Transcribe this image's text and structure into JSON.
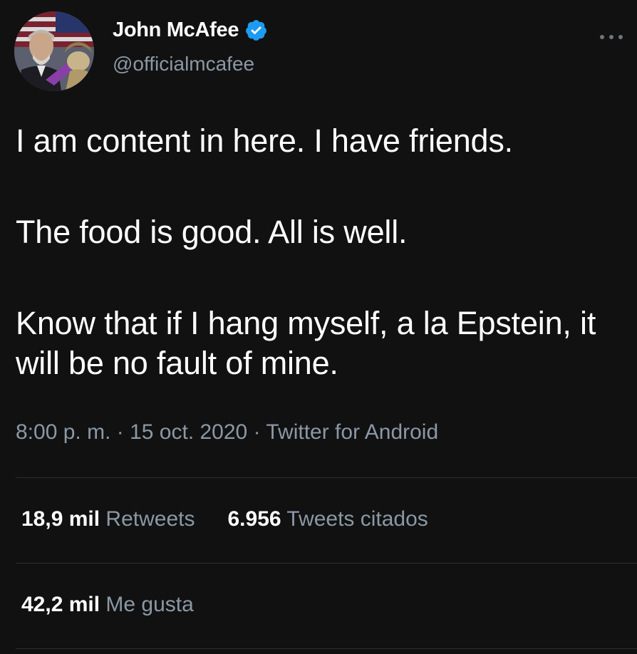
{
  "author": {
    "display_name": "John McAfee",
    "handle": "@officialmcafee",
    "verified": true,
    "verified_color": "#1d9bf0"
  },
  "more_icon": "more-horizontal-icon",
  "tweet": {
    "paragraphs": [
      "I am content in here. I have friends.",
      "The food is good. All is well.",
      "Know that if I hang myself, a la Epstein, it will be no fault of mine."
    ]
  },
  "meta": {
    "time": "8:00 p. m.",
    "date": "15 oct. 2020",
    "source": "Twitter for Android",
    "separator": "·"
  },
  "stats": {
    "retweets_count": "18,9 mil",
    "retweets_label": "Retweets",
    "quotes_count": "6.956",
    "quotes_label": "Tweets citados",
    "likes_count": "42,2 mil",
    "likes_label": "Me gusta"
  }
}
